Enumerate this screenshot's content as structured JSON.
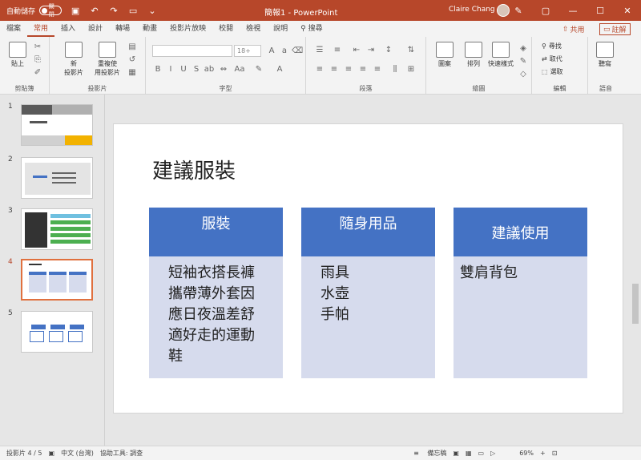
{
  "titlebar": {
    "autosave_label": "自動儲存",
    "autosave_state": "關閉",
    "doc_title": "簡報1 - PowerPoint",
    "user_name": "Claire Chang"
  },
  "tabs": [
    "檔案",
    "常用",
    "插入",
    "設計",
    "轉場",
    "動畫",
    "投影片放映",
    "校閱",
    "檢視",
    "說明"
  ],
  "search_label": "搜尋",
  "share_label": "共用",
  "comment_label": "註解",
  "ribbon": {
    "paste_label": "貼上",
    "clipboard_group": "剪貼簿",
    "new_slide_label": "新\n投影片",
    "reuse_slide_label": "重複使\n用投影片",
    "slides_group": "投影片",
    "font_size_placeholder": "18+",
    "font_group": "字型",
    "paragraph_group": "段落",
    "shapes_label": "圖案",
    "arrange_label": "排列",
    "quick_styles_label": "快速樣式",
    "drawing_group": "繪圖",
    "find_label": "尋找",
    "replace_label": "取代",
    "select_label": "選取",
    "editing_group": "編輯",
    "dictate_label": "聽寫",
    "voice_group": "語音"
  },
  "thumbnails": [
    "1",
    "2",
    "3",
    "4",
    "5"
  ],
  "slide": {
    "title": "建議服裝",
    "cards": [
      {
        "header": "服裝",
        "body": "短袖衣搭長褲攜帶薄外套因應日夜溫差舒適好走的運動鞋"
      },
      {
        "header": "隨身用品",
        "body": "雨具\n水壺\n手帕"
      },
      {
        "header": "建議使用",
        "body": "雙肩背包"
      }
    ]
  },
  "status": {
    "slide_count": "投影片 4 / 5",
    "language": "中文 (台灣)",
    "accessibility": "協助工具: 調查",
    "notes_label": "備忘稿",
    "zoom": "69%"
  },
  "colors": {
    "accent": "#b7472a",
    "card_header": "#4472c4",
    "card_body": "#d6dbed"
  }
}
